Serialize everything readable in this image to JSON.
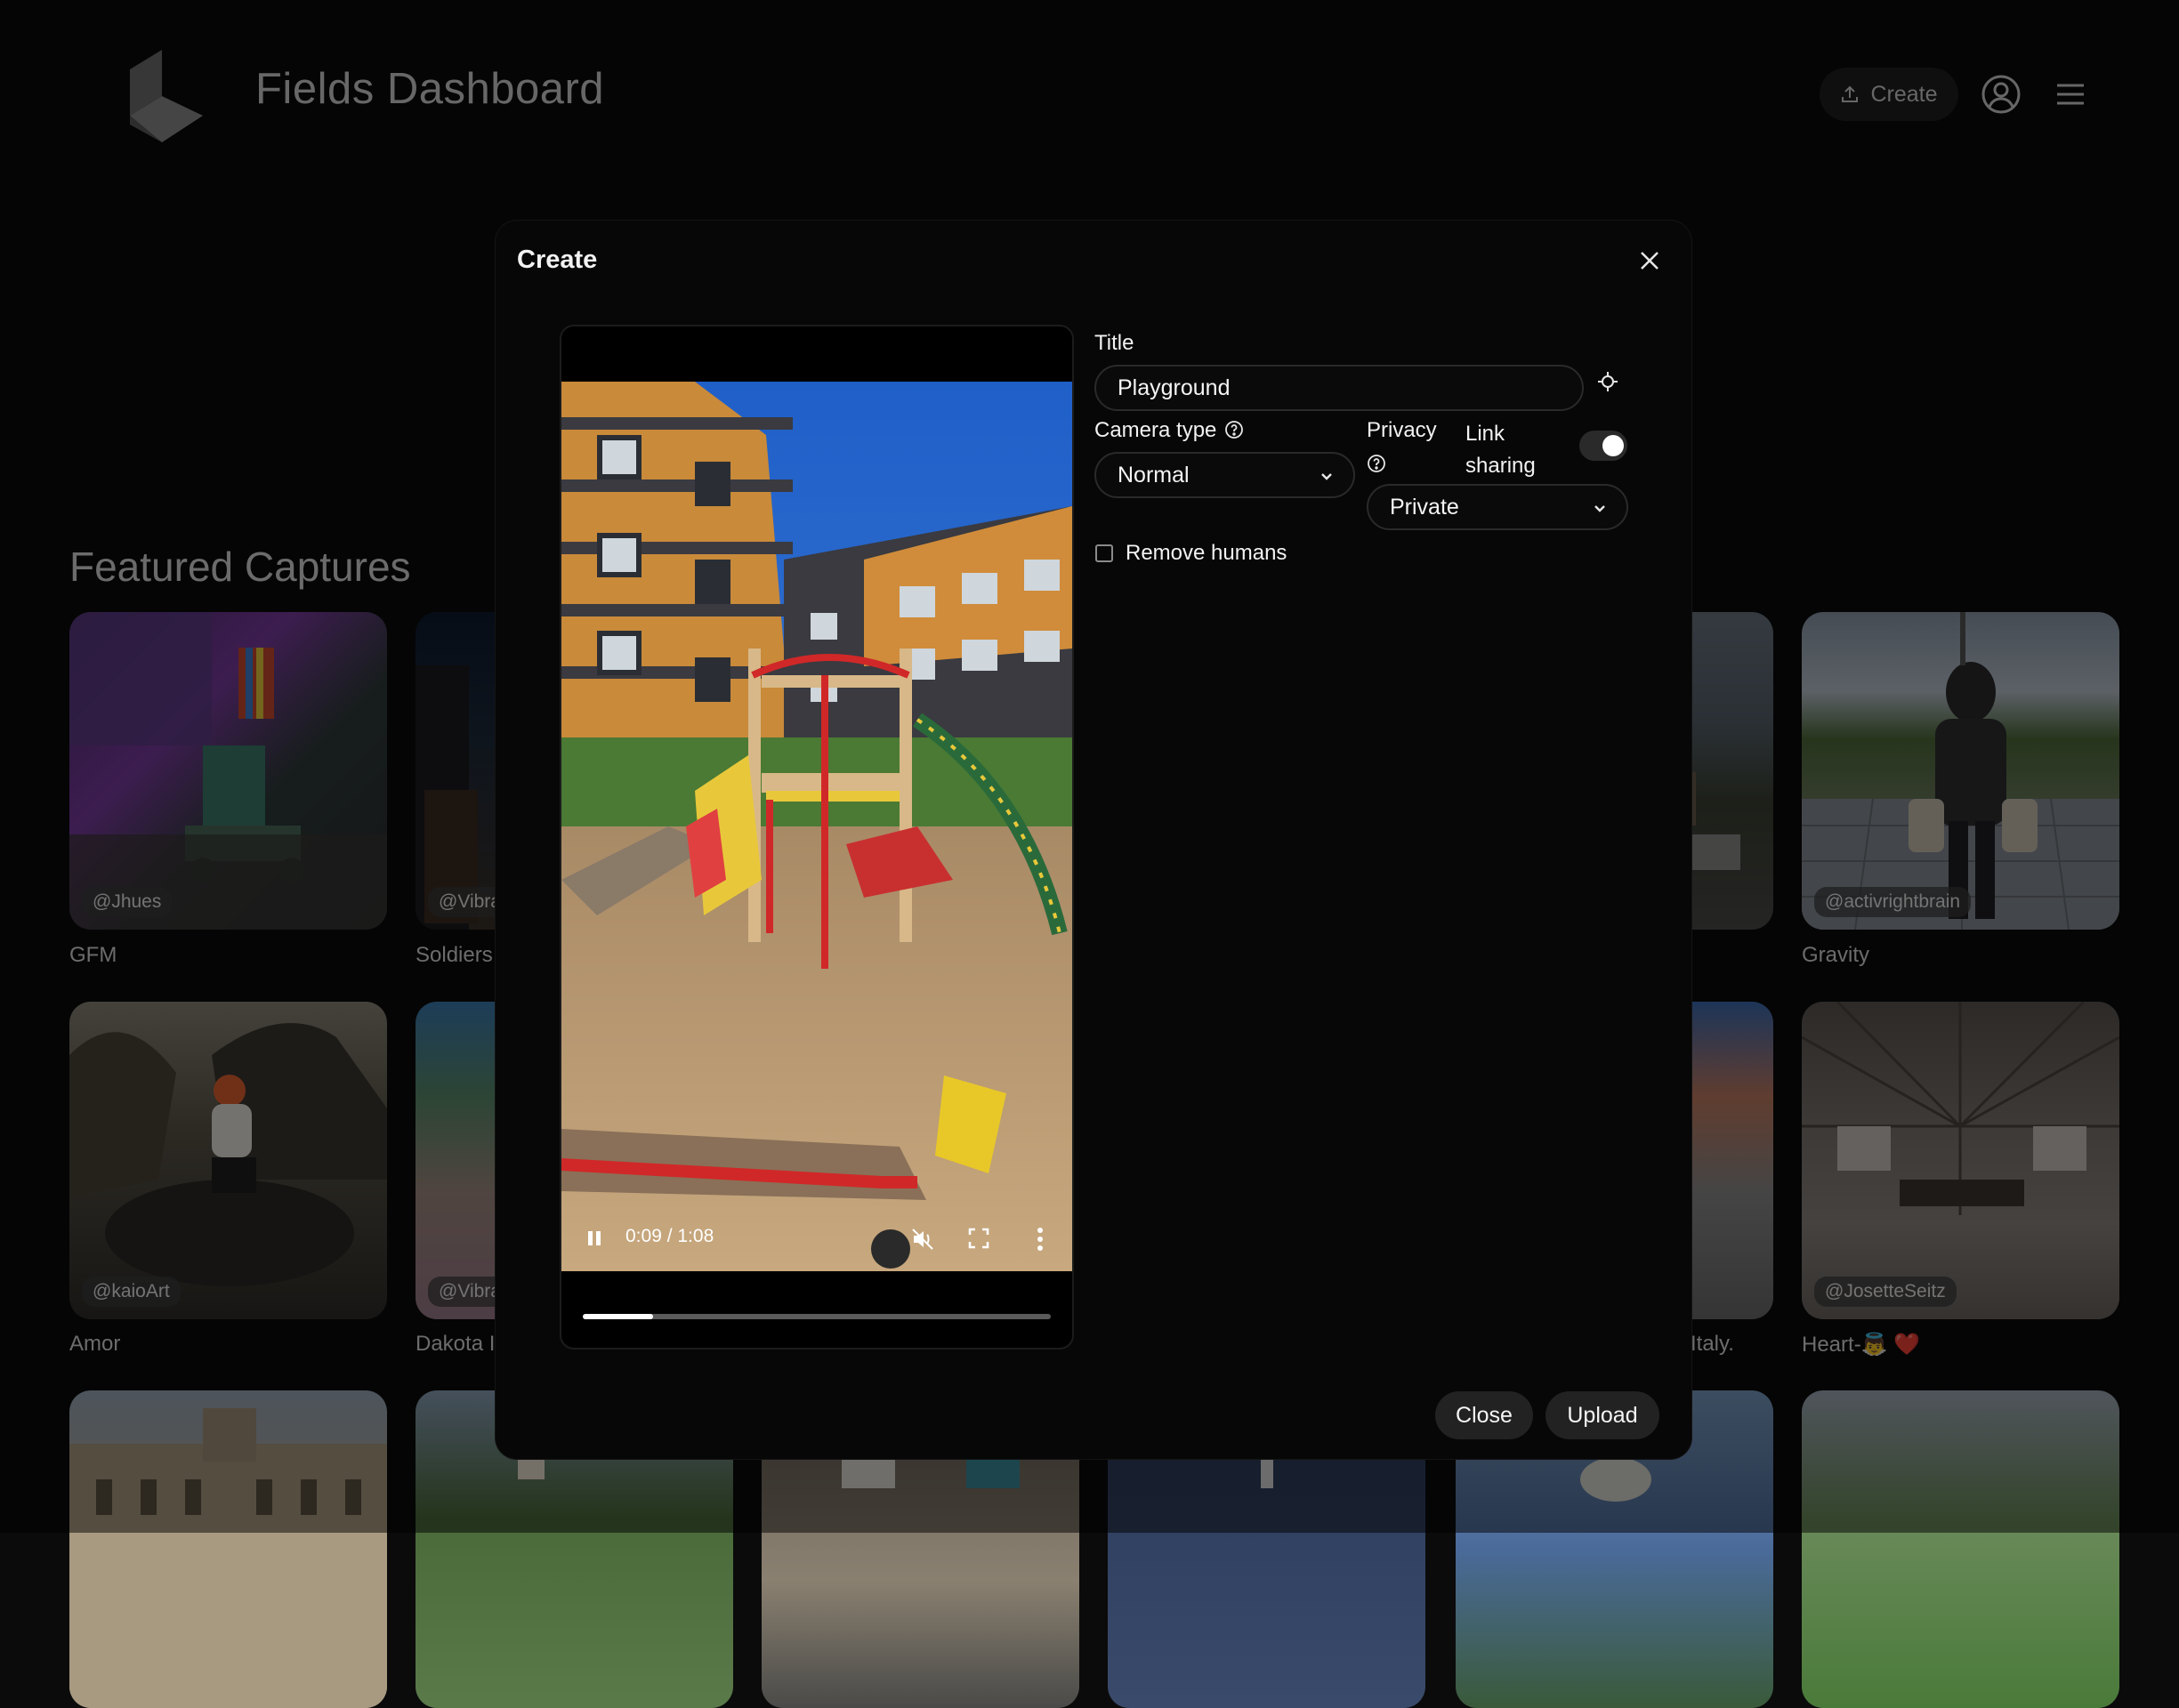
{
  "header": {
    "app_title": "Fields Dashboard",
    "create_label": "Create"
  },
  "featured": {
    "title": "Featured Captures",
    "cards": [
      {
        "handle": "@Jhues",
        "caption": "GFM"
      },
      {
        "handle": "@Vibra",
        "caption": "Soldiers"
      },
      {
        "handle": "@activrightbrain",
        "caption": "Gravity"
      },
      {
        "handle": "@kaioArt",
        "caption": "Amor"
      },
      {
        "handle": "@Vibra",
        "caption": "Dakota I"
      },
      {
        "handle": "",
        "caption": "Italy."
      },
      {
        "handle": "@JosetteSeitz",
        "caption": "Heart-👼 ❤️"
      }
    ]
  },
  "modal": {
    "title": "Create",
    "video": {
      "time": "0:09 / 1:08",
      "progress_fraction": 0.15
    },
    "form": {
      "title_label": "Title",
      "title_value": "Playground",
      "camera_type_label": "Camera type",
      "camera_type_value": "Normal",
      "privacy_label": "Privacy",
      "privacy_value": "Private",
      "link_sharing_label_line1": "Link",
      "link_sharing_label_line2": "sharing",
      "link_sharing_on": true,
      "remove_humans_label": "Remove humans",
      "remove_humans_checked": false
    },
    "buttons": {
      "close_label": "Close",
      "upload_label": "Upload"
    }
  }
}
